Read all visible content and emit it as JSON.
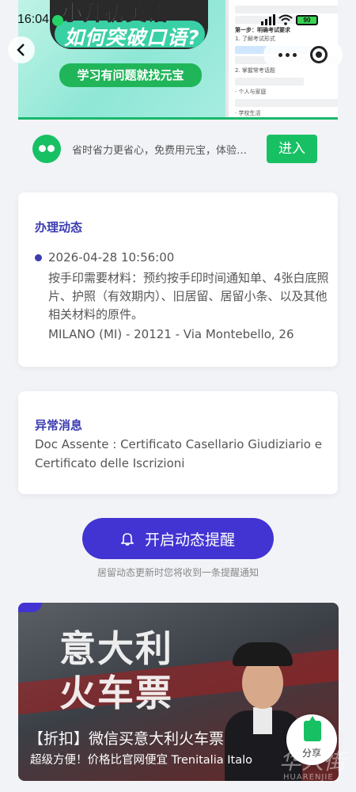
{
  "status_bar": {
    "time": "16:04",
    "battery": "90"
  },
  "banner": {
    "title_line1": "小升初英语",
    "title_line2": "如何突破口语?",
    "subtitle": "学习有问题就找元宝",
    "doc_heading": "第一步：明确考试要求",
    "doc_items": [
      "1. 了解考试形式",
      "2. 掌握常考话题",
      "· 个人与家庭",
      "· 学校生活"
    ]
  },
  "promo": {
    "text": "省时省力更省心，免费用元宝，体验…",
    "button": "进入"
  },
  "progress_card": {
    "title": "办理动态",
    "date": "2026-04-28 10:56:00",
    "description": "按手印需要材料：预约按手印时间通知单、4张白底照片、护照（有效期内）、旧居留、居留小条、以及其他相关材料的原件。",
    "address": "MILANO (MI) - 20121 - Via Montebello, 26"
  },
  "exception_card": {
    "title": "异常消息",
    "body": "Doc Assente : Certificato Casellario Giudiziario e Certificato delle Iscrizioni"
  },
  "reminder": {
    "button": "开启动态提醒",
    "hint": "居留动态更新时您将收到一条提醒通知"
  },
  "ad": {
    "big_text_line1": "意大利",
    "big_text_line2": "火车票",
    "title": "【折扣】微信买意大利火车票",
    "subtitle": "超级方便！价格比官网便宜 Trenitalia Italo"
  },
  "share": {
    "label": "分享"
  },
  "watermark": {
    "text": "华人街",
    "sub": "HUARENJIE"
  },
  "colors": {
    "accent": "#4234d2",
    "title": "#3b3cb0",
    "green": "#18c064"
  }
}
